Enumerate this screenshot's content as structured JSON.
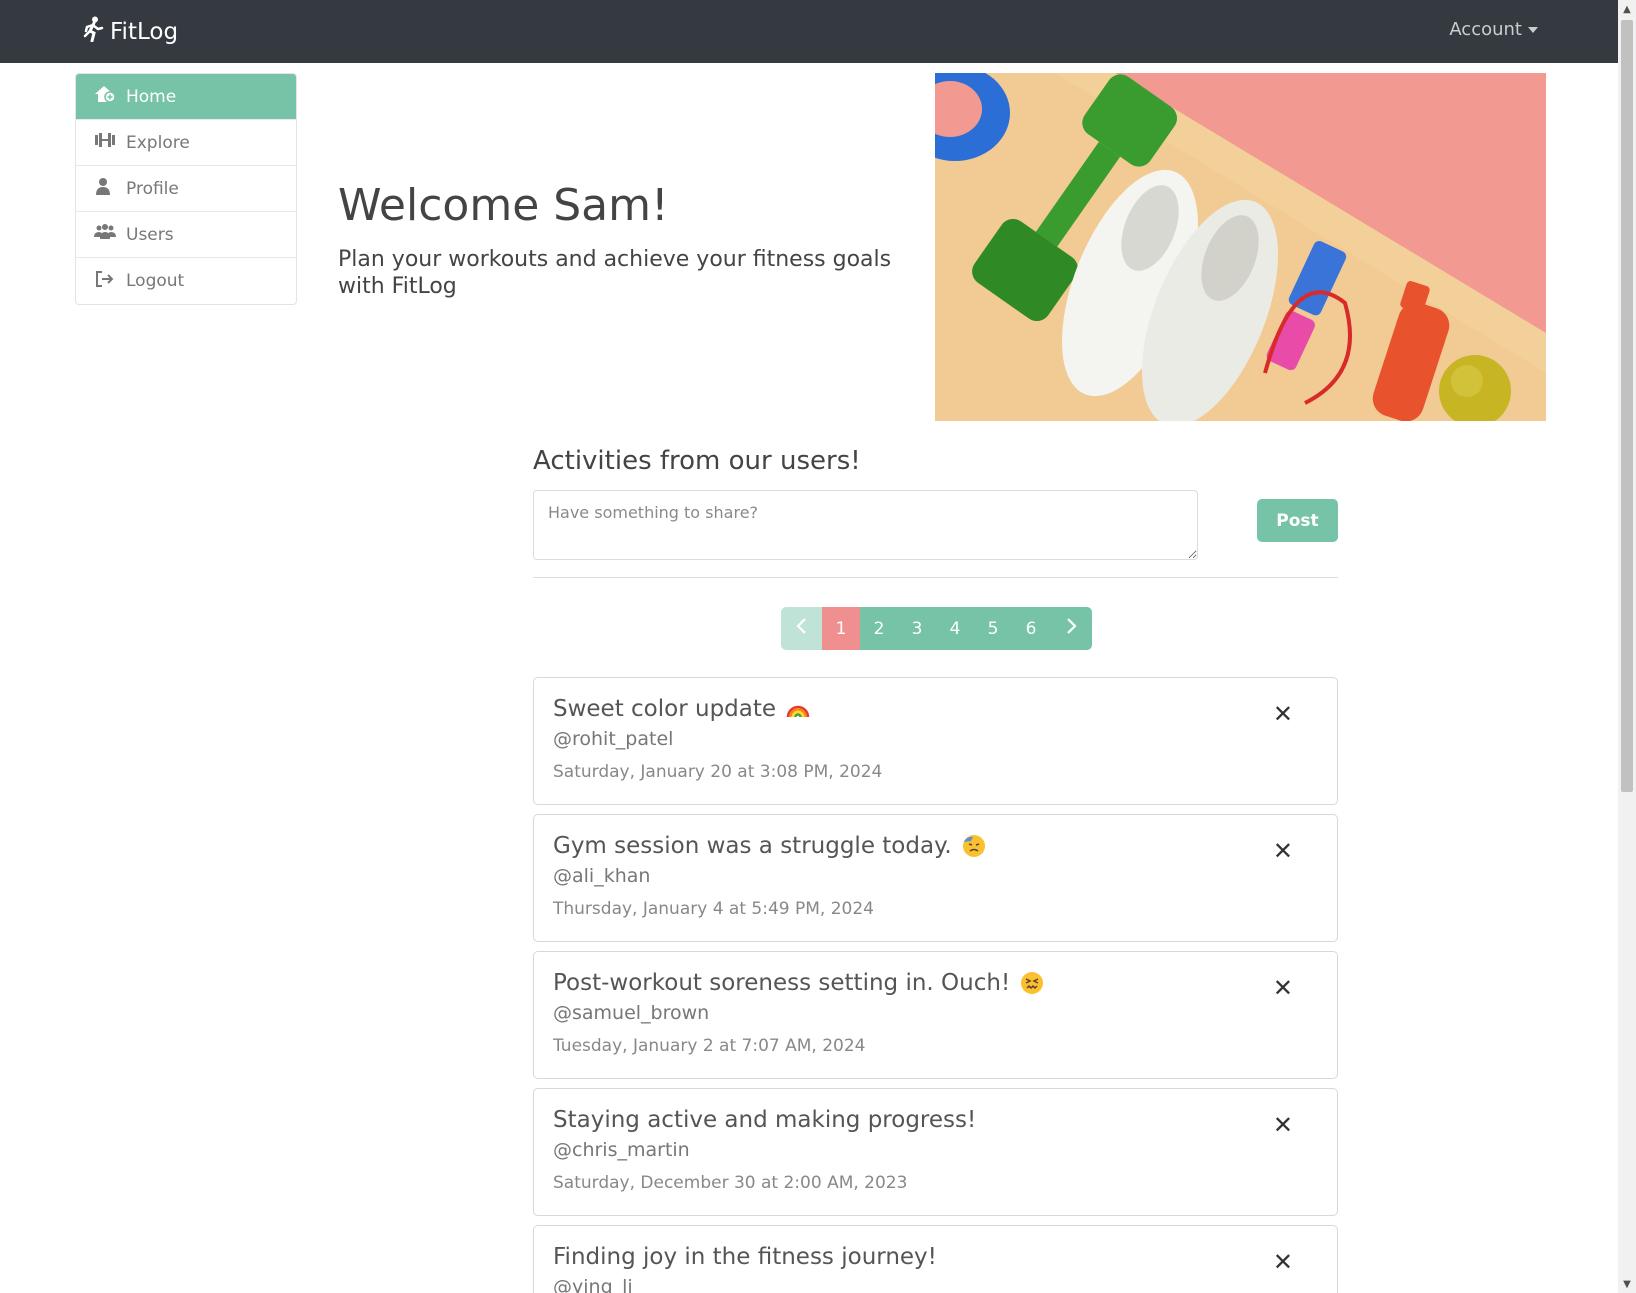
{
  "app": {
    "brand": "FitLog"
  },
  "navbar": {
    "account_label": "Account"
  },
  "sidebar": {
    "items": [
      {
        "label": "Home",
        "icon": "home-icon",
        "active": true
      },
      {
        "label": "Explore",
        "icon": "dumbbell-icon",
        "active": false
      },
      {
        "label": "Profile",
        "icon": "user-icon",
        "active": false
      },
      {
        "label": "Users",
        "icon": "users-icon",
        "active": false
      },
      {
        "label": "Logout",
        "icon": "logout-icon",
        "active": false
      }
    ]
  },
  "hero": {
    "title": "Welcome Sam!",
    "subtitle": "Plan your workouts and achieve your fitness goals with FitLog"
  },
  "activities": {
    "title": "Activities from our users!",
    "share_placeholder": "Have something to share?",
    "post_label": "Post"
  },
  "pagination": {
    "pages": [
      "1",
      "2",
      "3",
      "4",
      "5",
      "6"
    ],
    "current": "1"
  },
  "posts": [
    {
      "title": "Sweet color update",
      "emoji": "rainbow-emoji",
      "user": "@rohit_patel",
      "date": "Saturday, January 20 at 3:08 PM, 2024"
    },
    {
      "title": "Gym session was a struggle today.",
      "emoji": "downcast-sweat-emoji",
      "user": "@ali_khan",
      "date": "Thursday, January 4 at 5:49 PM, 2024"
    },
    {
      "title": "Post-workout soreness setting in. Ouch!",
      "emoji": "confounded-emoji",
      "user": "@samuel_brown",
      "date": "Tuesday, January 2 at 7:07 AM, 2024"
    },
    {
      "title": "Staying active and making progress!",
      "emoji": "",
      "user": "@chris_martin",
      "date": "Saturday, December 30 at 2:00 AM, 2023"
    },
    {
      "title": "Finding joy in the fitness journey!",
      "emoji": "",
      "user": "@ying_li",
      "date": ""
    }
  ],
  "colors": {
    "navbar": "#343a40",
    "accent": "#76c3a8",
    "pagination_current": "#ef8f8f"
  }
}
